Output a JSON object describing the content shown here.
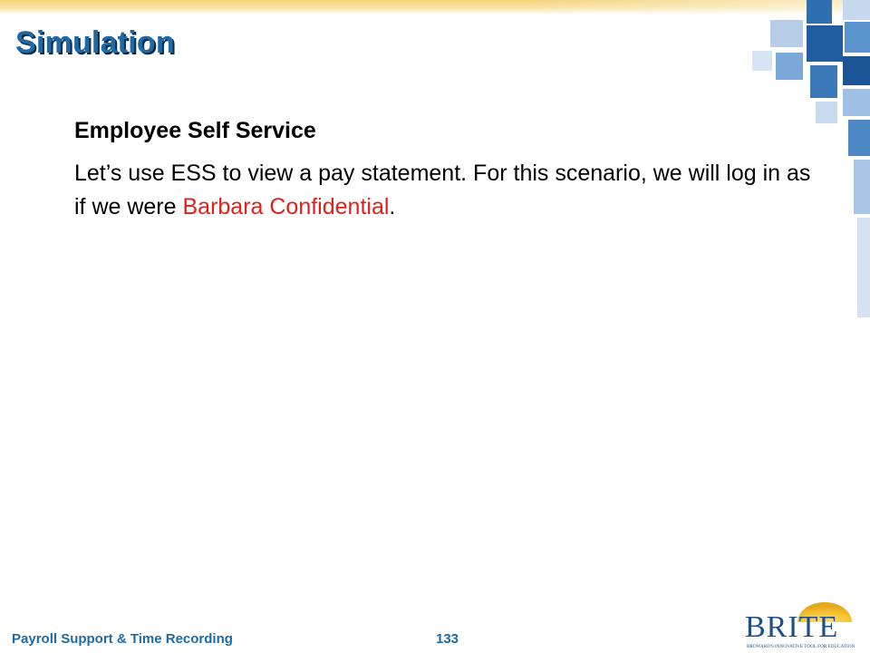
{
  "slide": {
    "title": "Simulation",
    "subheading": "Employee Self Service",
    "body": {
      "before": "Let’s use ESS to view a pay statement. For this scenario, we will log in as if we were ",
      "highlight": "Barbara Confidential",
      "after": "."
    }
  },
  "footer": {
    "course": "Payroll Support & Time Recording",
    "page_number": "133"
  },
  "logo": {
    "text": "BRITE",
    "tagline": "BROWARD'S INNOVATIVE TOOL FOR EDUCATION"
  },
  "colors": {
    "title": "#1f6aa5",
    "highlight": "#e0201b",
    "accent_gold": "#f4c430",
    "mosaic_blue": "#3f7fbf"
  }
}
